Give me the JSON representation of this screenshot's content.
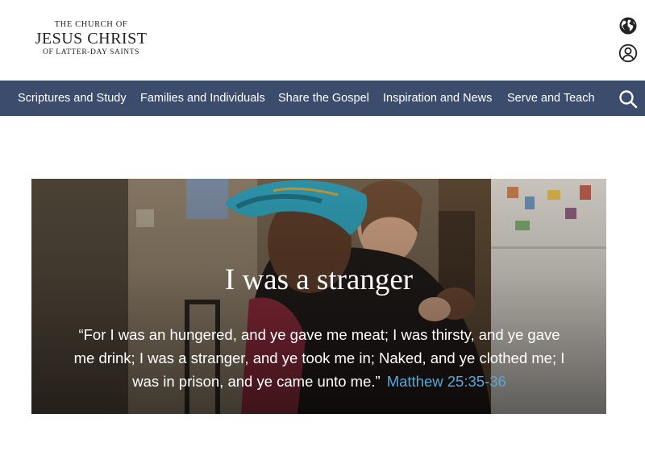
{
  "logo": {
    "line1": "THE CHURCH OF",
    "line2": "JESUS CHRIST",
    "line3": "OF LATTER-DAY SAINTS"
  },
  "header_icons": [
    "globe-icon",
    "account-icon"
  ],
  "nav": {
    "items": [
      {
        "label": "Scriptures and Study"
      },
      {
        "label": "Families and Individuals"
      },
      {
        "label": "Share the Gospel"
      },
      {
        "label": "Inspiration and News"
      },
      {
        "label": "Serve and Teach"
      }
    ],
    "search_icon": "search-icon"
  },
  "hero": {
    "title": "I was a stranger",
    "quote": "“For I was an hungered, and ye gave me meat; I was thirsty, and ye gave me drink; I was a stranger, and ye took me in; Naked, and ye clothed me; I was in prison, and ye came unto me.”",
    "reference": "Matthew 25:35-36"
  },
  "colors": {
    "nav_background": "#3c4c6c",
    "reference_link": "#5aa7d8"
  }
}
